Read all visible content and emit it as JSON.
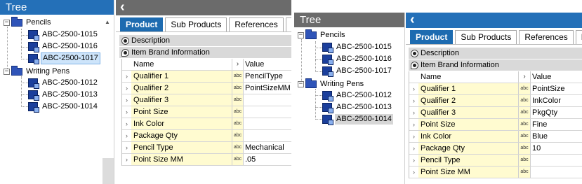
{
  "colors": {
    "header_blue": "#2470b8",
    "header_grey": "#6b6b6b",
    "tab_active": "#1d6bb0"
  },
  "left": {
    "tree": {
      "title": "Tree",
      "folders": [
        {
          "label": "Pencils",
          "items": [
            "ABC-2500-1015",
            "ABC-2500-1016",
            "ABC-2500-1017"
          ]
        },
        {
          "label": "Writing Pens",
          "items": [
            "ABC-2500-1012",
            "ABC-2500-1013",
            "ABC-2500-1014"
          ]
        }
      ],
      "selected": "ABC-2500-1017"
    },
    "detail": {
      "back_icon": "chevron-left-icon",
      "tabs": [
        "Product",
        "Sub Products",
        "References",
        "Re"
      ],
      "active_tab": "Product",
      "section_description": "Description",
      "section_brand": "Item Brand Information",
      "grid": {
        "header": {
          "name": "Name",
          "value": "Value"
        },
        "rows": [
          {
            "name": "Qualifier 1",
            "type": "abc",
            "value": "PencilType"
          },
          {
            "name": "Qualifier 2",
            "type": "abc",
            "value": "PointSizeMM"
          },
          {
            "name": "Qualifier 3",
            "type": "abc",
            "value": ""
          },
          {
            "name": "Point Size",
            "type": "abc",
            "value": ""
          },
          {
            "name": "Ink Color",
            "type": "abc",
            "value": ""
          },
          {
            "name": "Package Qty",
            "type": "abc",
            "value": ""
          },
          {
            "name": "Pencil Type",
            "type": "abc",
            "value": "Mechanical"
          },
          {
            "name": "Point Size MM",
            "type": "abc",
            "value": ".05"
          }
        ]
      }
    }
  },
  "right": {
    "tree": {
      "title": "Tree",
      "folders": [
        {
          "label": "Pencils",
          "items": [
            "ABC-2500-1015",
            "ABC-2500-1016",
            "ABC-2500-1017"
          ]
        },
        {
          "label": "Writing Pens",
          "items": [
            "ABC-2500-1012",
            "ABC-2500-1013",
            "ABC-2500-1014"
          ]
        }
      ],
      "selected": "ABC-2500-1014"
    },
    "detail": {
      "back_icon": "chevron-left-icon",
      "tabs": [
        "Product",
        "Sub Products",
        "References",
        "Ref"
      ],
      "active_tab": "Product",
      "section_description": "Description",
      "section_brand": "Item Brand Information",
      "grid": {
        "header": {
          "name": "Name",
          "value": "Value"
        },
        "rows": [
          {
            "name": "Qualifier 1",
            "type": "abc",
            "value": "PointSize"
          },
          {
            "name": "Qualifier 2",
            "type": "abc",
            "value": "InkColor"
          },
          {
            "name": "Qualifier 3",
            "type": "abc",
            "value": "PkgQty"
          },
          {
            "name": "Point Size",
            "type": "abc",
            "value": "Fine"
          },
          {
            "name": "Ink Color",
            "type": "abc",
            "value": "Blue"
          },
          {
            "name": "Package Qty",
            "type": "abc",
            "value": "10"
          },
          {
            "name": "Pencil Type",
            "type": "abc",
            "value": ""
          },
          {
            "name": "Point Size MM",
            "type": "abc",
            "value": ""
          }
        ]
      }
    }
  }
}
